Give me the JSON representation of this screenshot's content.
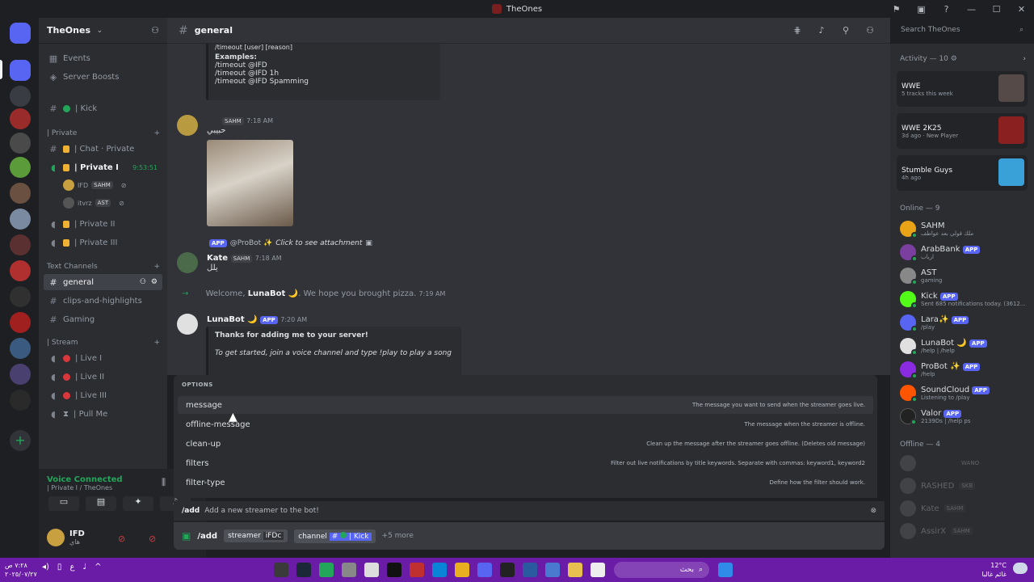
{
  "window": {
    "title": "TheOnes"
  },
  "guild": {
    "name": "TheOnes"
  },
  "sidebar": {
    "top_items": [
      {
        "label": "Events"
      },
      {
        "label": "Server Boosts"
      }
    ],
    "kick_channel": "| Kick",
    "private_category": "| Private",
    "private_channels": [
      {
        "label": "| Chat · Private"
      },
      {
        "label": "| Private I",
        "timer": "9:53:51"
      },
      {
        "label": "| Private II"
      },
      {
        "label": "| Private III"
      }
    ],
    "voice_users": [
      {
        "name": "IFD",
        "tag": "SAHM"
      },
      {
        "name": "itvrz",
        "tag": "AST"
      }
    ],
    "text_category": "Text Channels",
    "text_channels": [
      {
        "label": "general"
      },
      {
        "label": "clips-and-highlights"
      },
      {
        "label": "Gaming"
      }
    ],
    "stream_category": "| Stream",
    "stream_channels": [
      {
        "label": "| Live I"
      },
      {
        "label": "| Live II"
      },
      {
        "label": "| Live III"
      },
      {
        "label": "| Pull Me"
      }
    ]
  },
  "voice": {
    "status": "Voice Connected",
    "channel": "| Private I / TheOnes"
  },
  "user": {
    "name": "IFD",
    "status": "هاي"
  },
  "header": {
    "channel": "general",
    "search_placeholder": "Search TheOnes"
  },
  "messages": {
    "embed1": {
      "header": "/timeout [user] [reason]",
      "examples_label": "Examples:",
      "lines": [
        "/timeout @IFD",
        "/timeout @IFD 1h",
        "/timeout @IFD Spamming"
      ]
    },
    "m1": {
      "tag": "SAHM",
      "time": "7:18 AM",
      "text": "حبيبي"
    },
    "m2_reply": {
      "badge": "APP",
      "name": "@ProBot ✨",
      "text": "Click to see attachment"
    },
    "m2": {
      "name": "Kate",
      "tag": "SAHM",
      "time": "7:18 AM",
      "text": "يلل"
    },
    "join": {
      "pre": "Welcome, ",
      "name": "LunaBot 🌙",
      "post": ". We hope you brought pizza.",
      "time": "7:19 AM"
    },
    "m3": {
      "name": "LunaBot 🌙",
      "badge": "APP",
      "time": "7:20 AM"
    },
    "embed2": {
      "title": "Thanks for adding me to your server!",
      "line": "To get started, join a voice channel and type !play to play a song"
    }
  },
  "options": {
    "header": "OPTIONS",
    "items": [
      {
        "name": "message",
        "desc": "The message you want to send when the streamer goes live."
      },
      {
        "name": "offline-message",
        "desc": "The message when the streamer is offline."
      },
      {
        "name": "clean-up",
        "desc": "Clean up the message after the streamer goes offline. (Deletes old message)"
      },
      {
        "name": "filters",
        "desc": "Filter out live notifications by title keywords. Separate with commas: keyword1, keyword2"
      },
      {
        "name": "filter-type",
        "desc": "Define how the filter should work."
      }
    ]
  },
  "composer": {
    "command": "/add",
    "command_desc": "Add a new streamer to the bot!",
    "cmd": "/add",
    "arg1_name": "streamer",
    "arg1_value": "iFDc",
    "arg2_name": "channel",
    "arg2_value": "| Kick",
    "more": "+5 more"
  },
  "activity": {
    "header": "Activity — 10",
    "items": [
      {
        "title": "WWE",
        "detail": "5 tracks this week"
      },
      {
        "title": "WWE 2K25",
        "detail": "3d ago · New Player"
      },
      {
        "title": "Stumble Guys",
        "detail": "4h ago"
      }
    ]
  },
  "online": {
    "header": "Online — 9",
    "members": [
      {
        "name": "SAHM",
        "status": "ملك قولي بعد عواطف",
        "color": "#e8a317"
      },
      {
        "name": "ArabBank",
        "badge": "APP",
        "status": "ارباب",
        "color": "#7b3fa0"
      },
      {
        "name": "AST",
        "status": "gaming",
        "color": "#888888"
      },
      {
        "name": "Kick",
        "badge": "APP",
        "status": "Sent 685 notifications today. (3612...",
        "color": "#53fc18"
      },
      {
        "name": "Lara✨",
        "badge": "APP",
        "status": "/play",
        "color": "#5865f2"
      },
      {
        "name": "LunaBot 🌙",
        "badge": "APP",
        "status": "/help | /help",
        "color": "#e0e0e0"
      },
      {
        "name": "ProBot ✨",
        "badge": "APP",
        "status": "/help",
        "color": "#8a2be2"
      },
      {
        "name": "SoundCloud",
        "badge": "APP",
        "status": "Listening to /play",
        "color": "#ff5500"
      },
      {
        "name": "Valor",
        "badge": "APP",
        "status": "2139Ds | /help ps",
        "color": "#222222"
      }
    ]
  },
  "offline": {
    "header": "Offline — 4",
    "members": [
      {
        "name": "WANO"
      },
      {
        "name": "RASHED",
        "tag": "SKB"
      },
      {
        "name": "Kate",
        "tag": "SAHM"
      },
      {
        "name": "AssirX",
        "tag": "SAHM"
      }
    ]
  },
  "taskbar": {
    "time": "٧:٢٨ ص",
    "date": "٢٠٢٥/٠٧/٢٧",
    "search": "بحث",
    "temp": "12°C",
    "weather": "غائم غالبا"
  },
  "colors": {
    "accent": "#5865f2",
    "online": "#23a55a",
    "taskbar": "#6b1ca7"
  }
}
